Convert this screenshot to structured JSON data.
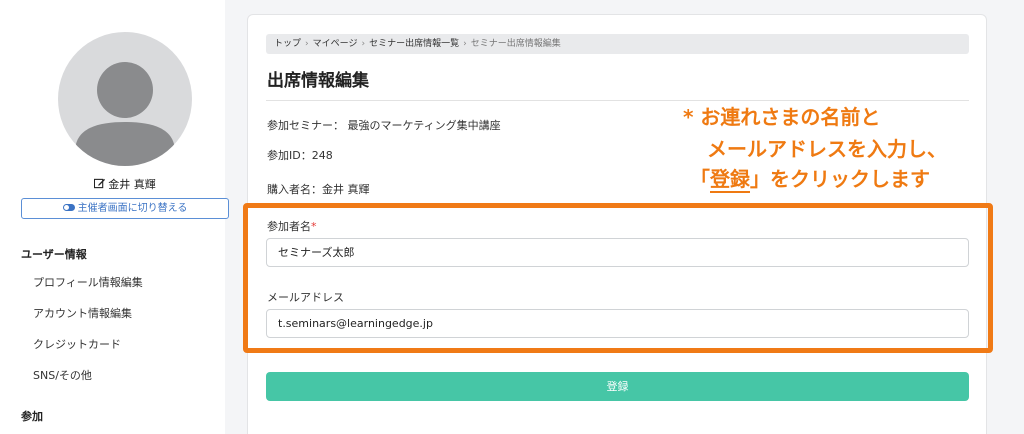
{
  "sidebar": {
    "user_name": "金井 真輝",
    "switch_button": "主催者画面に切り替える",
    "heading_user": "ユーザー情報",
    "items": [
      {
        "label": "プロフィール情報編集"
      },
      {
        "label": "アカウント情報編集"
      },
      {
        "label": "クレジットカード"
      },
      {
        "label": "SNS/その他"
      }
    ],
    "heading_participation": "参加"
  },
  "breadcrumb": {
    "items": [
      "トップ",
      "マイページ",
      "セミナー出席情報一覧",
      "セミナー出席情報編集"
    ],
    "separator": "›"
  },
  "page": {
    "title": "出席情報編集",
    "seminar": "参加セミナー： 最強のマーケティング集中講座",
    "participation_id": "参加ID：248",
    "purchaser": "購入者名：金井 真輝"
  },
  "form": {
    "name_label": "参加者名",
    "required_mark": "*",
    "name_value": "セミナーズ太郎",
    "email_label": "メールアドレス",
    "email_value": "t.seminars@learningedge.jp",
    "submit_label": "登録"
  },
  "annotation": {
    "line1": "* お連れさまの名前と",
    "line2": "メールアドレスを入力し、",
    "line3_pre": "「",
    "line3_word": "登録",
    "line3_post": "」をクリックします"
  },
  "colors": {
    "accent_green": "#46c6a6",
    "annotation_orange": "#ef7a12",
    "switch_blue": "#3b73c4"
  }
}
